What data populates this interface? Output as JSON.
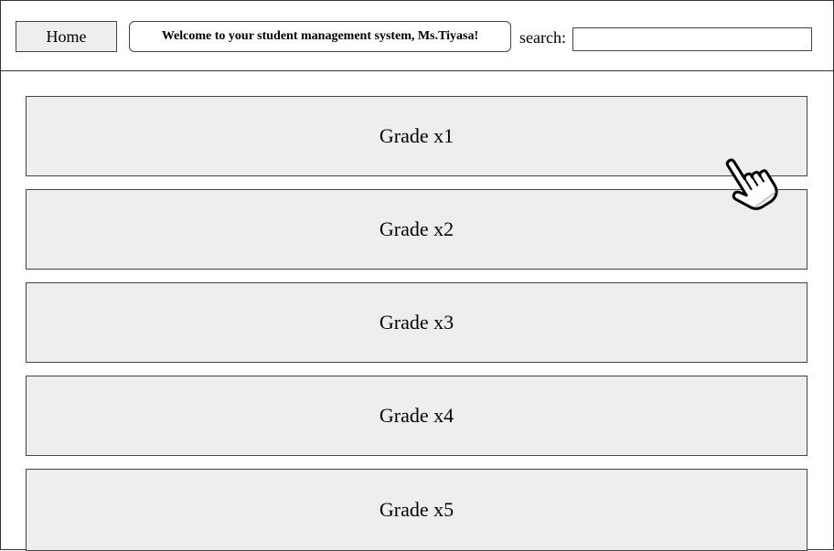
{
  "header": {
    "home_label": "Home",
    "welcome_text": "Welcome to your student management system, Ms.Tiyasa!",
    "search_label": "search:",
    "search_value": "",
    "search_placeholder": ""
  },
  "grades": [
    {
      "label": "Grade x1"
    },
    {
      "label": "Grade x2"
    },
    {
      "label": "Grade x3"
    },
    {
      "label": "Grade x4"
    },
    {
      "label": "Grade x5"
    }
  ],
  "icons": {
    "pointer": "hand-pointer-icon"
  },
  "colors": {
    "card_background": "#eeeeee",
    "border": "#444444",
    "page_background": "#ffffff"
  }
}
